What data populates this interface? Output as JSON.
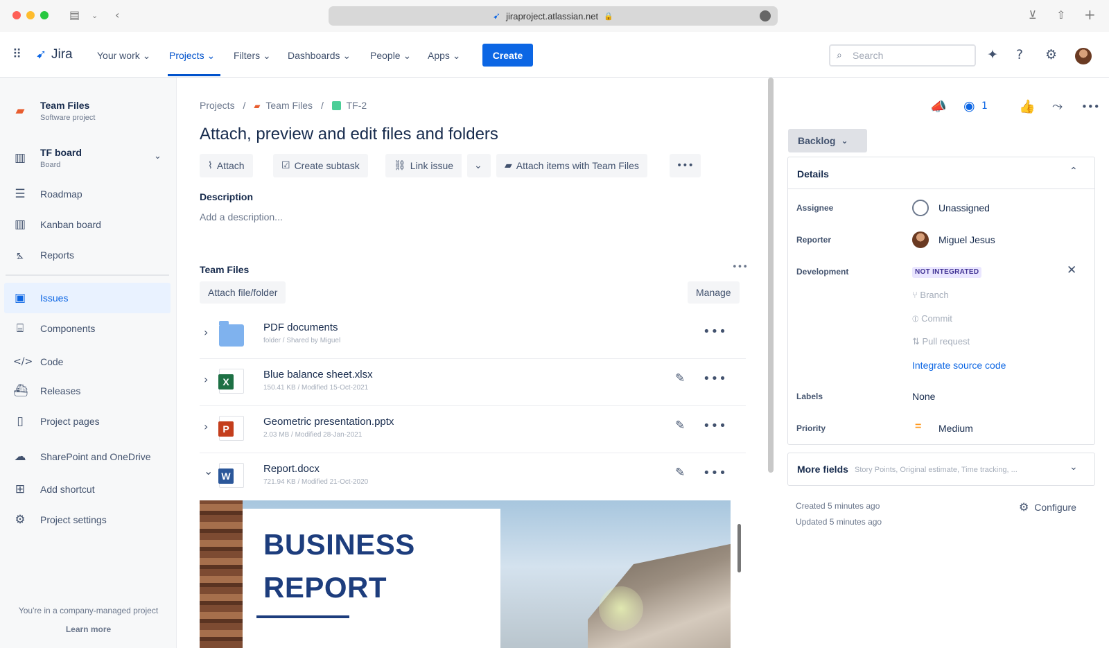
{
  "browser": {
    "url": "jiraproject.atlassian.net"
  },
  "topnav": {
    "logo_label": "Jira",
    "items": [
      "Your work",
      "Projects",
      "Filters",
      "Dashboards",
      "People",
      "Apps"
    ],
    "create_label": "Create",
    "search_placeholder": "Search"
  },
  "sidebar": {
    "project_name": "Team Files",
    "project_type": "Software project",
    "board_name": "TF board",
    "board_sub": "Board",
    "items": [
      "Roadmap",
      "Kanban board",
      "Reports",
      "Issues",
      "Components",
      "Code",
      "Releases",
      "Project pages",
      "SharePoint and OneDrive",
      "Add shortcut",
      "Project settings"
    ],
    "footer_text": "You're in a company-managed project",
    "footer_link": "Learn more"
  },
  "issue": {
    "breadcrumb": [
      "Projects",
      "Team Files",
      "TF-2"
    ],
    "title": "Attach, preview and edit files and folders",
    "actions": [
      "Attach",
      "Create subtask",
      "Link issue",
      "Attach items with Team Files"
    ],
    "description_label": "Description",
    "description_placeholder": "Add a description..."
  },
  "team_files": {
    "heading": "Team Files",
    "attach_button": "Attach file/folder",
    "manage_button": "Manage",
    "files": [
      {
        "name": "PDF documents",
        "meta": "folder / Shared by Miguel",
        "type": "folder"
      },
      {
        "name": "Blue balance sheet.xlsx",
        "meta": "150.41 KB / Modified 15-Oct-2021",
        "type": "xlsx"
      },
      {
        "name": "Geometric presentation.pptx",
        "meta": "2.03 MB / Modified 28-Jan-2021",
        "type": "pptx"
      },
      {
        "name": "Report.docx",
        "meta": "721.94 KB / Modified 21-Oct-2020",
        "type": "docx"
      }
    ],
    "preview_title_line1": "BUSINESS",
    "preview_title_line2": "REPORT"
  },
  "details_panel": {
    "watchers_count": "1",
    "status": "Backlog",
    "details_heading": "Details",
    "fields": {
      "assignee_label": "Assignee",
      "assignee_value": "Unassigned",
      "reporter_label": "Reporter",
      "reporter_value": "Miguel Jesus",
      "development_label": "Development",
      "development_badge": "NOT INTEGRATED",
      "dev_items": [
        "Branch",
        "Commit",
        "Pull request"
      ],
      "integrate_link": "Integrate source code",
      "labels_label": "Labels",
      "labels_value": "None",
      "priority_label": "Priority",
      "priority_value": "Medium"
    },
    "more_fields_label": "More fields",
    "more_fields_hint": "Story Points, Original estimate, Time tracking, ...",
    "created": "Created 5 minutes ago",
    "updated": "Updated 5 minutes ago",
    "configure_label": "Configure"
  },
  "colors": {
    "brand_blue": "#0c66e4",
    "nav_active": "#0052cc",
    "priority_medium": "#ff991f",
    "excel": "#1d7044",
    "powerpoint": "#c43e1c",
    "word": "#2b579a"
  }
}
